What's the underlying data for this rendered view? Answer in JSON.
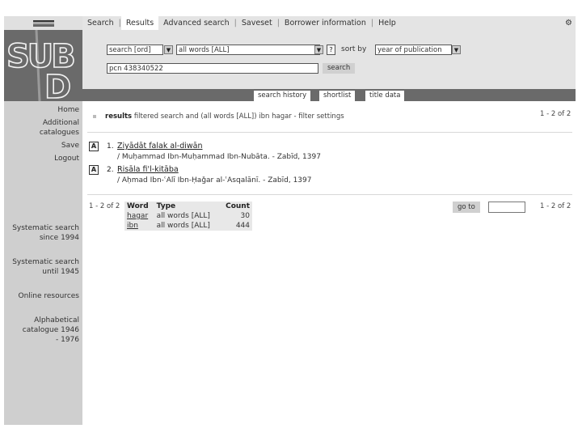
{
  "topnav": {
    "tabs": [
      "Search",
      "Results",
      "Advanced search",
      "Saveset",
      "Borrower information",
      "Help"
    ],
    "active_tab": "Results"
  },
  "search": {
    "field_select": "search [ord]",
    "scope_select": "all words [ALL]",
    "help_label": "?",
    "sort_label": "sort by",
    "sort_select": "year of publication",
    "query_value": "pcn 438340522",
    "search_button": "search"
  },
  "subtabs": [
    "search history",
    "shortlist",
    "title data"
  ],
  "sidebar": {
    "items": [
      "Home",
      "Additional catalogues",
      "Save",
      "Logout"
    ],
    "catalogues": [
      "Systematic search since 1994",
      "Systematic search until 1945",
      "Online resources",
      "Alphabetical catalogue 1946 - 1976"
    ]
  },
  "results": {
    "label": "results",
    "description": "filtered search and (all words [ALL]) ibn hagar - filter settings",
    "pager_top": "1 - 2 of 2",
    "pager_left": "1 - 2 of 2",
    "pager_bottom": "1 - 2 of 2",
    "entries": [
      {
        "num": "1.",
        "title": "Ziyādāt falak al-diwān",
        "author": "/ Muḥammad Ibn-Muḥammad Ibn-Nubāta. - Zabīd, 1397"
      },
      {
        "num": "2.",
        "title": "Risāla fi'l-kitāba",
        "author": "/ Aḥmad Ibn-ʿAlī Ibn-Ḥaǧar al-ʿAsqalānī. - Zabīd, 1397"
      }
    ]
  },
  "words": {
    "headers": [
      "Word",
      "Type",
      "Count"
    ],
    "rows": [
      {
        "word": "hagar",
        "type": "all words [ALL]",
        "count": "30"
      },
      {
        "word": "ibn",
        "type": "all words [ALL]",
        "count": "444"
      }
    ]
  },
  "goto_button": "go to",
  "colors": {
    "sidebar": "#cfcfcf",
    "topbar": "#e4e4e4",
    "dark_bar": "#6a6a6a"
  },
  "icons": {
    "settings": "gear-icon",
    "entry": "fulltext-icon"
  }
}
